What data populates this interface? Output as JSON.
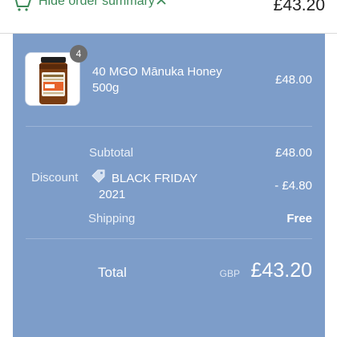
{
  "header": {
    "toggle_label": "Hide order summary",
    "total": "£43.20"
  },
  "product": {
    "quantity": "4",
    "name": "40 MGO Mānuka Honey 500g",
    "price": "£48.00"
  },
  "summary": {
    "subtotal_label": "Subtotal",
    "subtotal_value": "£48.00",
    "discount_label": "Discount",
    "discount_code": "BLACK FRIDAY 2021",
    "discount_value": "- £4.80",
    "shipping_label": "Shipping",
    "shipping_value": "Free",
    "total_label": "Total",
    "currency": "GBP",
    "total_value": "£43.20"
  },
  "colors": {
    "accent": "#3c8a58",
    "panel": "#7d9dc9"
  }
}
